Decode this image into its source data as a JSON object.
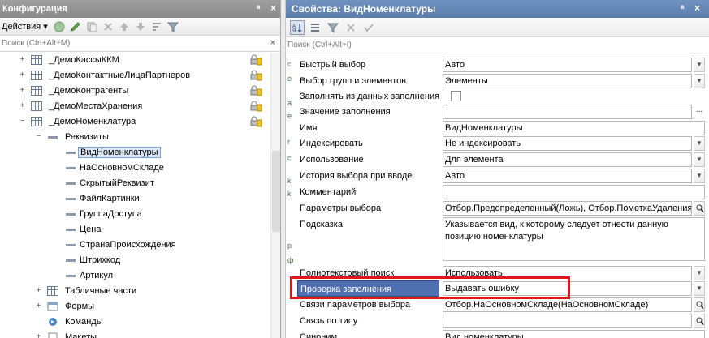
{
  "config_panel": {
    "title": "Конфигурация",
    "pin": "ᵃ",
    "actions_label": "Действия ▾",
    "search_placeholder": "Поиск (Ctrl+Alt+M)",
    "tree": [
      {
        "label": "_ДемоКассыККМ",
        "level": 1,
        "icon": "table",
        "expand": "+"
      },
      {
        "label": "_ДемоКонтактныеЛицаПартнеров",
        "level": 1,
        "icon": "table",
        "expand": "+"
      },
      {
        "label": "_ДемоКонтрагенты",
        "level": 1,
        "icon": "table",
        "expand": "+"
      },
      {
        "label": "_ДемоМестаХранения",
        "level": 1,
        "icon": "table",
        "expand": "+"
      },
      {
        "label": "_ДемоНоменклатура",
        "level": 1,
        "icon": "table",
        "expand": "−"
      },
      {
        "label": "Реквизиты",
        "level": 2,
        "icon": "attr",
        "expand": "−"
      },
      {
        "label": "ВидНоменклатуры",
        "level": 3,
        "icon": "attr",
        "selected": true
      },
      {
        "label": "НаОсновномСкладе",
        "level": 3,
        "icon": "attr"
      },
      {
        "label": "СкрытыйРеквизит",
        "level": 3,
        "icon": "attr"
      },
      {
        "label": "ФайлКартинки",
        "level": 3,
        "icon": "attr"
      },
      {
        "label": "ГруппаДоступа",
        "level": 3,
        "icon": "attr"
      },
      {
        "label": "Цена",
        "level": 3,
        "icon": "attr"
      },
      {
        "label": "СтранаПроисхождения",
        "level": 3,
        "icon": "attr"
      },
      {
        "label": "Штрихкод",
        "level": 3,
        "icon": "attr"
      },
      {
        "label": "Артикул",
        "level": 3,
        "icon": "attr"
      },
      {
        "label": "Табличные части",
        "level": 2,
        "icon": "table",
        "expand": "+"
      },
      {
        "label": "Формы",
        "level": 2,
        "icon": "form",
        "expand": "+"
      },
      {
        "label": "Команды",
        "level": 2,
        "icon": "cmd"
      },
      {
        "label": "Макеты",
        "level": 2,
        "icon": "tmpl",
        "expand": "+"
      }
    ]
  },
  "props_panel": {
    "title": "Свойства: ВидНоменклатуры",
    "pin": "ᵃ",
    "close": "×",
    "search_placeholder": "Поиск (Ctrl+Alt+I)",
    "rows": [
      {
        "label": "Быстрый выбор",
        "value": "Авто",
        "control": "dropdown"
      },
      {
        "label": "Выбор групп и элементов",
        "value": "Элементы",
        "control": "dropdown"
      },
      {
        "label": "Заполнять из данных заполнения",
        "value": "",
        "control": "checkbox"
      },
      {
        "label": "Значение заполнения",
        "value": "",
        "control": "dots"
      },
      {
        "label": "Имя",
        "value": "ВидНоменклатуры",
        "control": "none"
      },
      {
        "label": "Индексировать",
        "value": "Не индексировать",
        "control": "dropdown"
      },
      {
        "label": "Использование",
        "value": "Для элемента",
        "control": "dropdown"
      },
      {
        "label": "История выбора при вводе",
        "value": "Авто",
        "control": "dropdown"
      },
      {
        "label": "Комментарий",
        "value": "",
        "control": "none"
      },
      {
        "label": "Параметры выбора",
        "value": "Отбор.Предопределенный(Ложь), Отбор.ПометкаУдаления(",
        "control": "search"
      },
      {
        "label": "Подсказка",
        "value": "Указывается вид, к которому следует отнести данную позицию номенклатуры",
        "control": "textarea"
      },
      {
        "label": "Полнотекстовый поиск",
        "value": "Использовать",
        "control": "dropdown"
      },
      {
        "label": "Проверка заполнения",
        "value": "Выдавать ошибку",
        "control": "dropdown",
        "highlighted": true
      },
      {
        "label": "Связи параметров выбора",
        "value": "Отбор.НаОсновномСкладе(НаОсновномСкладе)",
        "control": "search"
      },
      {
        "label": "Связь по типу",
        "value": "",
        "control": "search"
      },
      {
        "label": "Синоним",
        "value": "Вид номенклатуры",
        "control": "none"
      }
    ]
  }
}
